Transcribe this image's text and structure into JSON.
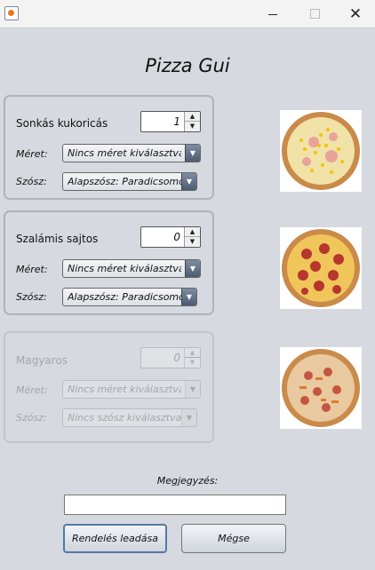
{
  "window": {
    "title": "",
    "minimize": "—",
    "maximize": "☐",
    "close": "✕"
  },
  "app_title": "Pizza Gui",
  "pizzas": [
    {
      "name": "Sonkás kukoricás",
      "quantity": "1",
      "size_label": "Méret:",
      "size_value": "Nincs méret kiválasztva!",
      "sauce_label": "Szósz:",
      "sauce_value": "Alapszósz: Paradicsomos",
      "enabled": true,
      "image_icon": "pizza-ham-corn-image"
    },
    {
      "name": "Szalámis sajtos",
      "quantity": "0",
      "size_label": "Méret:",
      "size_value": "Nincs méret kiválasztva!",
      "sauce_label": "Szósz:",
      "sauce_value": "Alapszósz: Paradicsomos",
      "enabled": true,
      "image_icon": "pizza-salami-cheese-image"
    },
    {
      "name": "Magyaros",
      "quantity": "0",
      "size_label": "Méret:",
      "size_value": "Nincs méret kiválasztva!",
      "sauce_label": "Szósz:",
      "sauce_value": "Nincs szósz kiválasztva!",
      "enabled": false,
      "image_icon": "pizza-hungarian-image"
    }
  ],
  "note": {
    "label": "Megjegyzés:",
    "value": "",
    "placeholder": ""
  },
  "buttons": {
    "order": "Rendelés leadása",
    "cancel": "Mégse"
  },
  "colors": {
    "background": "#d6d9df",
    "combo_arrow": "#4d5b70",
    "focus_border": "#5577aa"
  }
}
